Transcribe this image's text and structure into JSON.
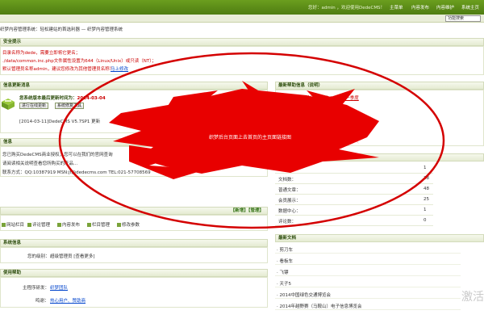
{
  "topbar": {
    "welcome": "您好：admin ，欢迎使用DedeCMS！",
    "links": [
      "主菜单",
      "内容发布",
      "内容维护",
      "系统主页"
    ]
  },
  "nav": {
    "search_value": "功能搜索"
  },
  "breadcrumb": "织梦内容管理系统：轻松建站的首选利器 — 织梦内容管理系统",
  "security": {
    "header": "安全提示",
    "lines": [
      "目录名称为dede，需要立即将它更名；",
      "./data/common.inc.php文件属性设置为644（Linux/Unix）或只读（NT）；",
      "默认管理员名称admin，建议您修改为其他管理员名称！"
    ],
    "modify_link": "马上修改"
  },
  "update": {
    "header": "信息更新消息",
    "version_label": "您系统版本最后更新时间为：",
    "version_date": "2014-03-04",
    "btn_online": "进行在线更新",
    "btn_check": "系统修复工具",
    "news_line": "[2014-03-11]DedeCMS V5.7SP1 更新"
  },
  "notice": {
    "header": "信息",
    "lines": [
      "您已购买DedeCMS商业授权，您可以在我们的官网查询",
      "请阅读相关说明查看您所购买的产品...",
      "联系方式：QQ:10387919 MSN:jt@dedecms.com TEL:021-57708569"
    ]
  },
  "quick": {
    "header_right": "【新增】【管理】",
    "items": [
      "网站栏目",
      "评论管理",
      "内容发布",
      "栏目管理",
      "修改参数"
    ]
  },
  "info": {
    "header": "系统信息",
    "role_label": "您的级别：",
    "role_value": "超级管理员 [查看更多]"
  },
  "dev": {
    "header": "使用帮助",
    "main_label": "主程序研发：",
    "main_value": "织梦团队",
    "thanks_label": "鸣谢：",
    "thanks_value": "热心用户、赞助商"
  },
  "help": {
    "header": "最新帮助信息（说明）",
    "line1": "中国安全购物网站 2014第一季度"
  },
  "stats": {
    "header": "信息统计",
    "rows": [
      {
        "label": "会员数：",
        "value": "1"
      },
      {
        "label": "文档数：",
        "value": "38"
      },
      {
        "label": "普通文章：",
        "value": "48"
      },
      {
        "label": "会员展示：",
        "value": "25"
      },
      {
        "label": "数据中心：",
        "value": "1"
      },
      {
        "label": "评论数：",
        "value": "0"
      }
    ]
  },
  "docs": {
    "header": "最新文档",
    "items": [
      "· 剪刀车",
      "· 看板车",
      "· 飞镖",
      "· 天子5",
      "· 2014中国绿色交通博览会",
      "· 2014年越野赛（马鞍山）电子信息博览会"
    ]
  },
  "overlay": {
    "stamp_text": "织梦后台页面上去首页的主页面链接图",
    "color": "#e80000"
  },
  "watermark": "激活"
}
